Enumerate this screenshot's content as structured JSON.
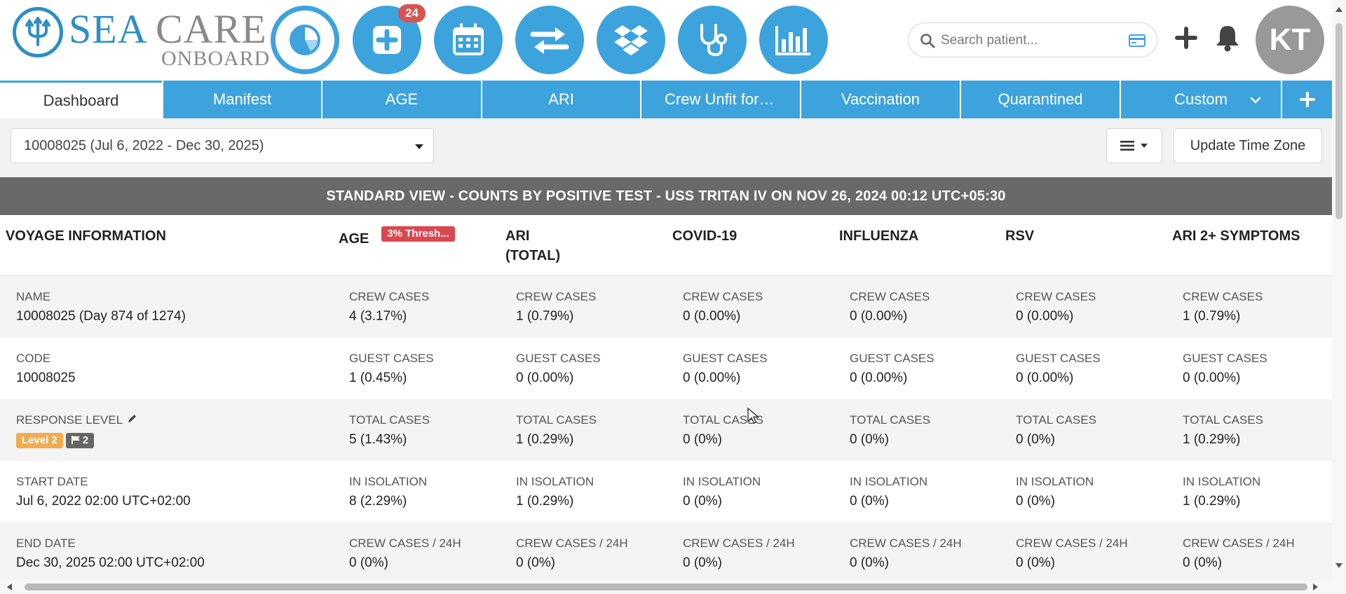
{
  "header": {
    "logo": {
      "sea": "SEA",
      "care": "CARE",
      "onboard": "ONBOARD"
    },
    "nav_icons": [
      {
        "icon": "pie-chart-icon",
        "active": true
      },
      {
        "icon": "add-case-icon",
        "badge": "24"
      },
      {
        "icon": "calendar-icon"
      },
      {
        "icon": "transfer-arrows-icon"
      },
      {
        "icon": "dropbox-icon"
      },
      {
        "icon": "stethoscope-icon"
      },
      {
        "icon": "bar-chart-icon"
      }
    ],
    "search": {
      "placeholder": "Search patient..."
    },
    "avatar_initials": "KT"
  },
  "tabs": [
    {
      "label": "Dashboard",
      "active": true
    },
    {
      "label": "Manifest"
    },
    {
      "label": "AGE"
    },
    {
      "label": "ARI"
    },
    {
      "label": "Crew Unfit for D..."
    },
    {
      "label": "Vaccination"
    },
    {
      "label": "Quarantined"
    },
    {
      "label": "Custom"
    }
  ],
  "toolbar": {
    "voyage_select": "10008025 (Jul 6, 2022 - Dec 30, 2025)",
    "update_tz": "Update Time Zone"
  },
  "banner": "STANDARD VIEW - COUNTS BY POSITIVE TEST - USS TRITAN IV ON NOV 26, 2024 00:12 UTC+05:30",
  "columns": {
    "voyage": "VOYAGE INFORMATION",
    "age": "AGE",
    "age_threshold": "3% Thresh...",
    "ari_line1": "ARI",
    "ari_line2": "(TOTAL)",
    "covid": "COVID-19",
    "influenza": "INFLUENZA",
    "rsv": "RSV",
    "ari2": "ARI 2+ SYMPTOMS"
  },
  "voyage_info": [
    {
      "label": "NAME",
      "value": "10008025 (Day 874 of 1274)"
    },
    {
      "label": "CODE",
      "value": "10008025"
    },
    {
      "label": "RESPONSE LEVEL",
      "level_badge": "Level 2",
      "flag_count": "2"
    },
    {
      "label": "START DATE",
      "value": "Jul 6, 2022 02:00 UTC+02:00"
    },
    {
      "label": "END DATE",
      "value": "Dec 30, 2025 02:00 UTC+02:00"
    }
  ],
  "metric_labels": [
    "CREW CASES",
    "GUEST CASES",
    "TOTAL CASES",
    "IN ISOLATION",
    "CREW CASES / 24H"
  ],
  "stats": {
    "age": [
      "4 (3.17%)",
      "1 (0.45%)",
      "5 (1.43%)",
      "8 (2.29%)",
      "0 (0%)"
    ],
    "ari": [
      "1 (0.79%)",
      "0 (0.00%)",
      "1 (0.29%)",
      "1 (0.29%)",
      "0 (0%)"
    ],
    "covid": [
      "0 (0.00%)",
      "0 (0.00%)",
      "0 (0%)",
      "0 (0%)",
      "0 (0%)"
    ],
    "influenza": [
      "0 (0.00%)",
      "0 (0.00%)",
      "0 (0%)",
      "0 (0%)",
      "0 (0%)"
    ],
    "rsv": [
      "0 (0.00%)",
      "0 (0.00%)",
      "0 (0%)",
      "0 (0%)",
      "0 (0%)"
    ],
    "ari2": [
      "1 (0.79%)",
      "0 (0.00%)",
      "1 (0.29%)",
      "1 (0.29%)",
      "0 (0%)"
    ]
  },
  "colors": {
    "accent": "#3da3dd",
    "danger": "#d9474f",
    "warning": "#f0ad4e",
    "banner": "#696969"
  }
}
